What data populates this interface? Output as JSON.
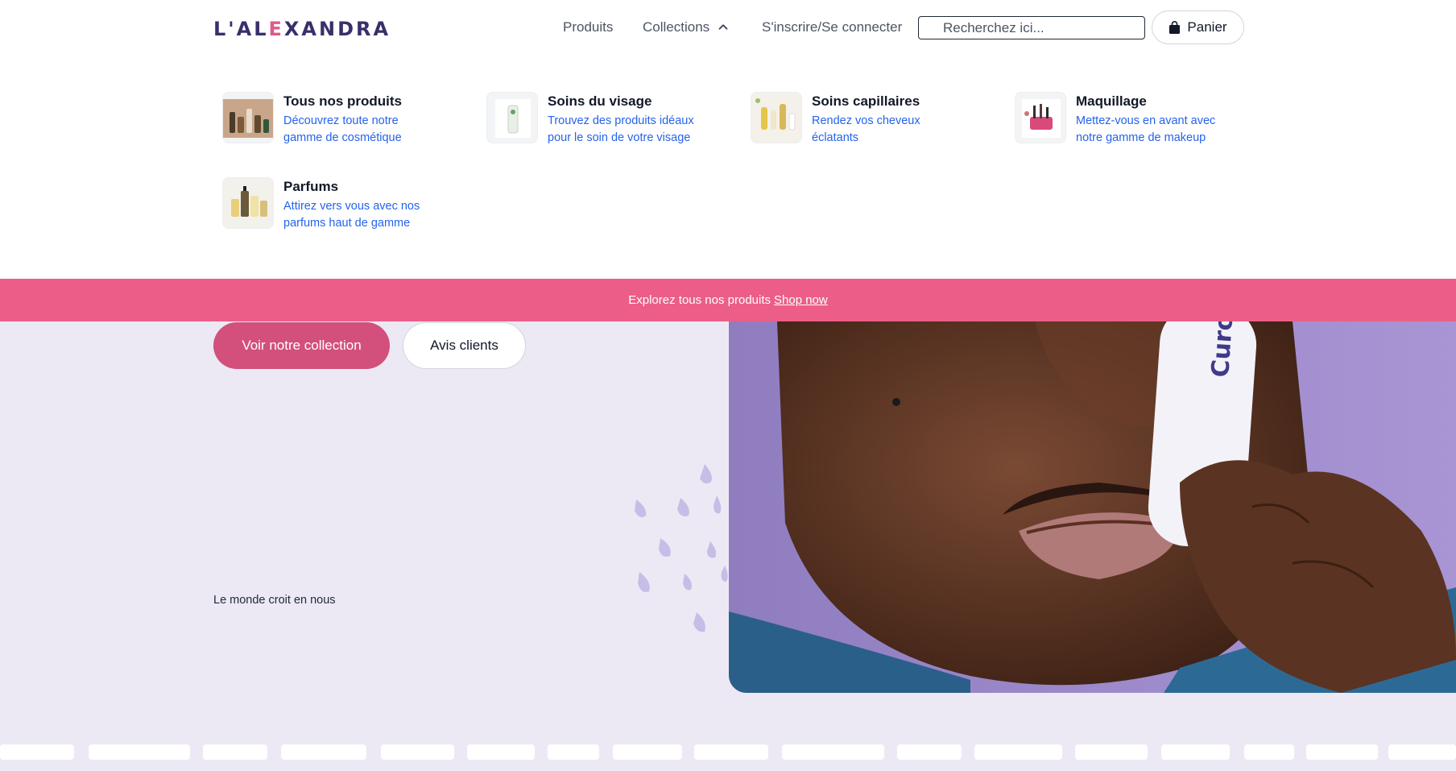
{
  "header": {
    "logo": {
      "prefix": "L'AL",
      "accent": "E",
      "suffix": "XANDRA"
    },
    "nav": {
      "produits": "Produits",
      "collections": "Collections",
      "login": "S'inscrire/Se connecter"
    },
    "search": {
      "placeholder": "Recherchez ici..."
    },
    "cart": {
      "label": "Panier"
    }
  },
  "mega_menu": {
    "items": [
      {
        "title": "Tous nos produits",
        "desc": "Découvrez toute notre gamme de cosmétique"
      },
      {
        "title": "Soins du visage",
        "desc": "Trouvez des produits idéaux pour le soin de votre visage"
      },
      {
        "title": "Soins capillaires",
        "desc": "Rendez vos cheveux éclatants"
      },
      {
        "title": "Maquillage",
        "desc": "Mettez-vous en avant avec notre gamme de makeup"
      },
      {
        "title": "Parfums",
        "desc": "Attirez vers vous avec nos parfums haut de gamme"
      }
    ]
  },
  "banner": {
    "text": "Explorez tous nos produits",
    "link": "Shop now"
  },
  "hero": {
    "primary_button": "Voir notre collection",
    "secondary_button": "Avis clients",
    "trust_text": "Le monde croit en nous",
    "product_brand": "Curolog"
  },
  "colors": {
    "brand": "#37306b",
    "accent": "#ec5e87",
    "primary_button": "#d2507b",
    "hero_bg": "#ece9f5",
    "link": "#2563eb"
  }
}
